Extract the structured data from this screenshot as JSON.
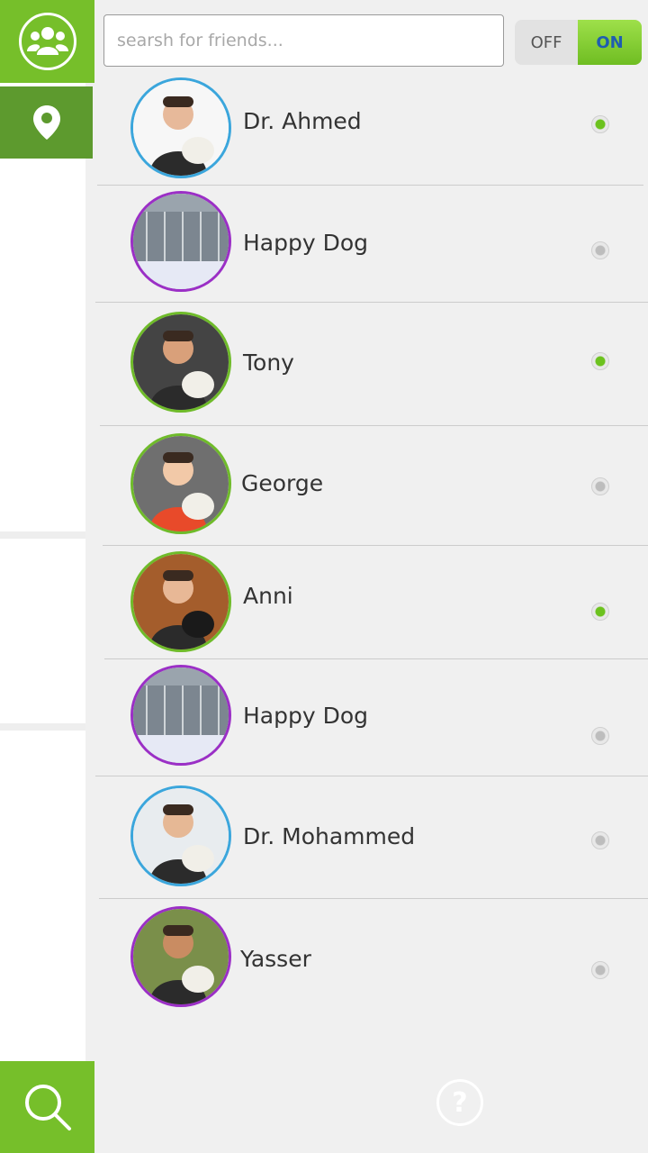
{
  "search": {
    "placeholder": "searsh for friends..."
  },
  "toggle": {
    "off_label": "OFF",
    "on_label": "ON",
    "state": "on"
  },
  "sidebar": {
    "items": [
      {
        "icon": "friends-group-icon"
      },
      {
        "icon": "location-pin-icon"
      }
    ],
    "search_icon": "search-icon"
  },
  "friends": [
    {
      "name": "Dr. Ahmed",
      "ring_color": "#3ba6dc",
      "online": true
    },
    {
      "name": "Happy Dog",
      "ring_color": "#9b2fc6",
      "online": false
    },
    {
      "name": "Tony",
      "ring_color": "#6fbb2a",
      "online": true
    },
    {
      "name": "George",
      "ring_color": "#6fbb2a",
      "online": false
    },
    {
      "name": "Anni",
      "ring_color": "#6fbb2a",
      "online": true
    },
    {
      "name": "Happy Dog",
      "ring_color": "#9b2fc6",
      "online": false
    },
    {
      "name": "Dr. Mohammed",
      "ring_color": "#3ba6dc",
      "online": false
    },
    {
      "name": "Yasser",
      "ring_color": "#9b2fc6",
      "online": false
    }
  ],
  "help_icon": "help-icon",
  "colors": {
    "accent": "#76bf2a",
    "accent_dark": "#5d9a2e",
    "online": "#6cc21e",
    "offline": "#bdbdbd"
  }
}
